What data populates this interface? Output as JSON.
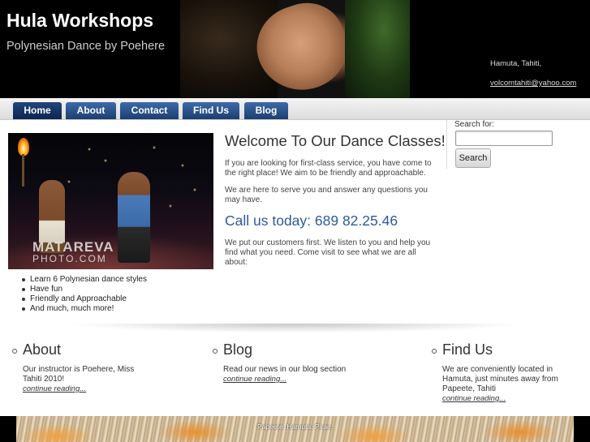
{
  "header": {
    "title": "Hula Workshops",
    "tagline": "Polynesian Dance by Poehere",
    "location": "Hamuta, Tahiti,",
    "email": "volcomtahiti@yahoo.com"
  },
  "nav": {
    "items": [
      {
        "label": "Home",
        "active": true
      },
      {
        "label": "About",
        "active": false
      },
      {
        "label": "Contact",
        "active": false
      },
      {
        "label": "Find Us",
        "active": false
      },
      {
        "label": "Blog",
        "active": false
      }
    ]
  },
  "main": {
    "photo_watermark": "MATAREVA",
    "photo_watermark_sub": "PHOTO.COM",
    "features": [
      "Learn 6 Polynesian dance styles",
      "Have fun",
      "Friendly and Approachable",
      "And much, much more!"
    ],
    "welcome_title": "Welcome To Our Dance Classes!",
    "para1": "If you are looking for first-class service, you have come to the right place! We aim to be friendly and approachable.",
    "para2": "We are here to serve you and answer any questions you may have.",
    "call": "Call us today: 689 82.25.46",
    "para3": "We put our customers first. We listen to you and help you find what you need. Come visit to see what we are all about:"
  },
  "search": {
    "label": "Search for:",
    "value": "",
    "button_label": "Search"
  },
  "columns": [
    {
      "title": "About",
      "text": "Our instructor is Poehere, Miss Tahiti 2010!",
      "link": "continue reading..."
    },
    {
      "title": "Blog",
      "text": "Read our news in our blog section",
      "link": "continue reading..."
    },
    {
      "title": "Find Us",
      "text": "We are conveniently located in Hamuta, just minutes away from Papeete, Tahiti",
      "link": "continue reading..."
    }
  ],
  "footer": {
    "text": "Papeete. Hamuta. Pirae."
  },
  "colors": {
    "nav_blue": "#1c3e70",
    "call_blue": "#2d5a9a",
    "header_bg": "#000000"
  }
}
